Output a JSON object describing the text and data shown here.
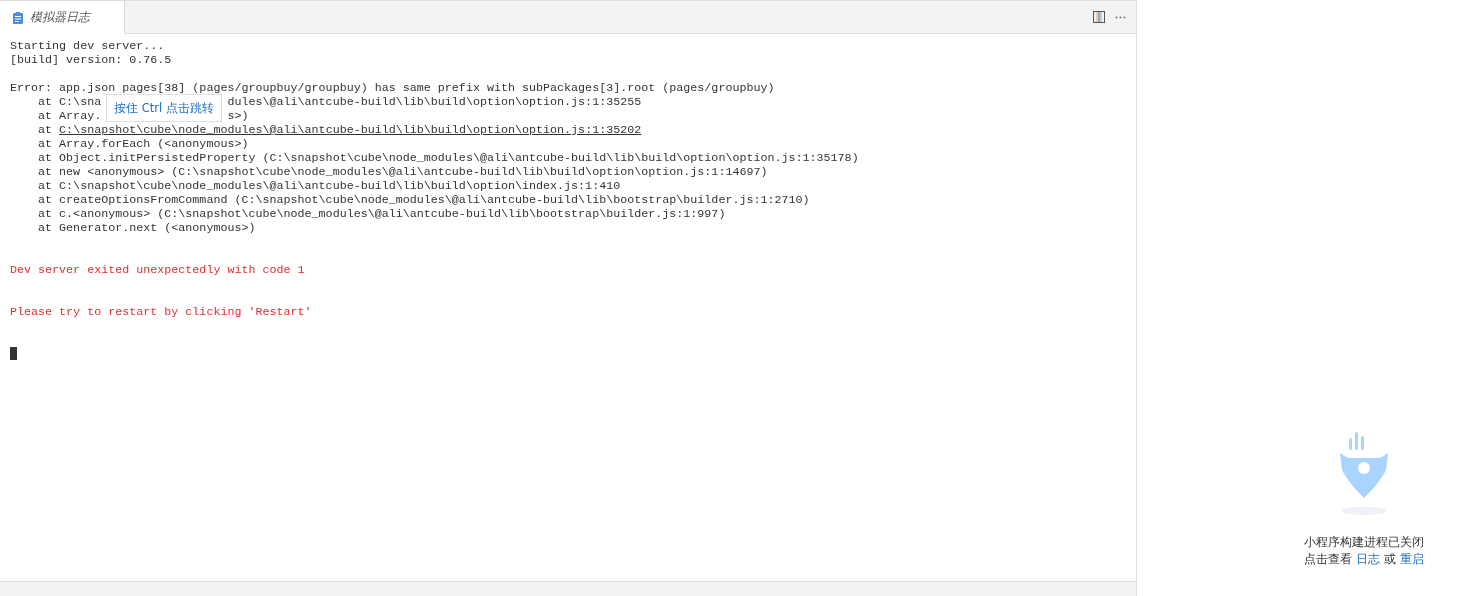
{
  "tab": {
    "title": "模拟器日志",
    "selected": true
  },
  "log": [
    {
      "kind": "plain",
      "parts": [
        "Starting dev server..."
      ]
    },
    {
      "kind": "plain",
      "parts": [
        "[build] version: 0.76.5"
      ]
    },
    {
      "kind": "blank"
    },
    {
      "kind": "plain",
      "parts": [
        "Error: app.json pages[38] (pages/groupbuy/groupbuy) has same prefix with subPackages[3].root (pages/groupbuy)"
      ]
    },
    {
      "kind": "plain",
      "parts": [
        "    at C:\\sna",
        "dules\\@ali\\antcube-build\\lib\\build\\option\\option.js:1:35255"
      ]
    },
    {
      "kind": "plain",
      "parts": [
        "    at Array.",
        "s>)"
      ]
    },
    {
      "kind": "link",
      "parts": [
        "    at ",
        "C:\\snapshot\\cube\\node_modules\\@ali\\antcube-build\\lib\\build\\option\\option.js:1:35202"
      ]
    },
    {
      "kind": "plain",
      "parts": [
        "    at Array.forEach (<anonymous>)"
      ]
    },
    {
      "kind": "plain",
      "parts": [
        "    at Object.initPersistedProperty (C:\\snapshot\\cube\\node_modules\\@ali\\antcube-build\\lib\\build\\option\\option.js:1:35178)"
      ]
    },
    {
      "kind": "plain",
      "parts": [
        "    at new <anonymous> (C:\\snapshot\\cube\\node_modules\\@ali\\antcube-build\\lib\\build\\option\\option.js:1:14697)"
      ]
    },
    {
      "kind": "plain",
      "parts": [
        "    at C:\\snapshot\\cube\\node_modules\\@ali\\antcube-build\\lib\\build\\option\\index.js:1:410"
      ]
    },
    {
      "kind": "plain",
      "parts": [
        "    at createOptionsFromCommand (C:\\snapshot\\cube\\node_modules\\@ali\\antcube-build\\lib\\bootstrap\\builder.js:1:2710)"
      ]
    },
    {
      "kind": "plain",
      "parts": [
        "    at c.<anonymous> (C:\\snapshot\\cube\\node_modules\\@ali\\antcube-build\\lib\\bootstrap\\builder.js:1:997)"
      ]
    },
    {
      "kind": "plain",
      "parts": [
        "    at Generator.next (<anonymous>)"
      ]
    },
    {
      "kind": "blank"
    },
    {
      "kind": "blank"
    },
    {
      "kind": "error",
      "parts": [
        "Dev server exited unexpectedly with code 1"
      ]
    },
    {
      "kind": "blank"
    },
    {
      "kind": "blank"
    },
    {
      "kind": "error",
      "parts": [
        "Please try to restart by clicking 'Restart'"
      ]
    },
    {
      "kind": "blank"
    },
    {
      "kind": "blank"
    },
    {
      "kind": "cursor"
    }
  ],
  "tooltip": "按住 Ctrl 点击跳转",
  "status": {
    "title": "小程序构建进程已关闭",
    "prefix": "点击查看",
    "log_link": "日志",
    "or": "或",
    "restart_link": "重启"
  }
}
